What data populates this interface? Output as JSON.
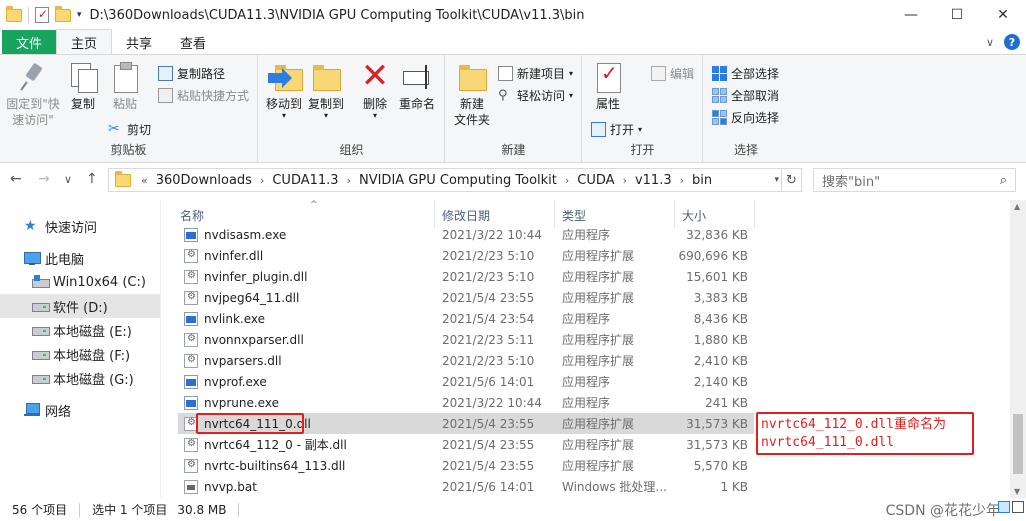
{
  "titlebar": {
    "path": "D:\\360Downloads\\CUDA11.3\\NVIDIA GPU Computing Toolkit\\CUDA\\v11.3\\bin",
    "minimize": "—",
    "maximize": "☐",
    "close": "✕",
    "qa_dropdown": "▾"
  },
  "tabs": {
    "file": "文件",
    "home": "主页",
    "share": "共享",
    "view": "查看",
    "expand": "∨",
    "help": "?"
  },
  "ribbon": {
    "clipboard": {
      "label": "剪贴板",
      "pin": "固定到\"快速访问\"",
      "copy": "复制",
      "paste": "粘贴",
      "copy_path": "复制路径",
      "paste_shortcut": "粘贴快捷方式",
      "cut": "剪切"
    },
    "organize": {
      "label": "组织",
      "move_to": "移动到",
      "copy_to": "复制到",
      "delete": "删除",
      "rename": "重命名"
    },
    "new": {
      "label": "新建",
      "new_folder": "新建\n文件夹",
      "new_item": "新建项目",
      "easy_access": "轻松访问"
    },
    "open": {
      "label": "打开",
      "properties": "属性",
      "open": "打开",
      "edit": "编辑"
    },
    "select": {
      "label": "选择",
      "select_all": "全部选择",
      "select_none": "全部取消",
      "invert": "反向选择"
    }
  },
  "address": {
    "back": "←",
    "forward": "→",
    "recent": "∨",
    "up": "↑",
    "overflow": "«",
    "crumbs": [
      "360Downloads",
      "CUDA11.3",
      "NVIDIA GPU Computing Toolkit",
      "CUDA",
      "v11.3",
      "bin"
    ],
    "refresh": "↻",
    "search_placeholder": "搜索\"bin\"",
    "search_icon": "⌕"
  },
  "nav": {
    "quick_access": "快速访问",
    "this_pc": "此电脑",
    "drive_c": "Win10x64 (C:)",
    "drive_d": "软件 (D:)",
    "drive_e": "本地磁盘 (E:)",
    "drive_f": "本地磁盘 (F:)",
    "drive_g": "本地磁盘 (G:)",
    "network": "网络"
  },
  "columns": {
    "name": "名称",
    "date": "修改日期",
    "type": "类型",
    "size": "大小",
    "sort": "^"
  },
  "files": [
    {
      "name": "nvdisasm.exe",
      "date": "2021/3/22 10:44",
      "type": "应用程序",
      "size": "32,836 KB",
      "icon": "exe"
    },
    {
      "name": "nvinfer.dll",
      "date": "2021/2/23 5:10",
      "type": "应用程序扩展",
      "size": "690,696 KB",
      "icon": "dll"
    },
    {
      "name": "nvinfer_plugin.dll",
      "date": "2021/2/23 5:10",
      "type": "应用程序扩展",
      "size": "15,601 KB",
      "icon": "dll"
    },
    {
      "name": "nvjpeg64_11.dll",
      "date": "2021/5/4 23:55",
      "type": "应用程序扩展",
      "size": "3,383 KB",
      "icon": "dll"
    },
    {
      "name": "nvlink.exe",
      "date": "2021/5/4 23:54",
      "type": "应用程序",
      "size": "8,436 KB",
      "icon": "exe"
    },
    {
      "name": "nvonnxparser.dll",
      "date": "2021/2/23 5:11",
      "type": "应用程序扩展",
      "size": "1,880 KB",
      "icon": "dll"
    },
    {
      "name": "nvparsers.dll",
      "date": "2021/2/23 5:10",
      "type": "应用程序扩展",
      "size": "2,410 KB",
      "icon": "dll"
    },
    {
      "name": "nvprof.exe",
      "date": "2021/5/6 14:01",
      "type": "应用程序",
      "size": "2,140 KB",
      "icon": "exe"
    },
    {
      "name": "nvprune.exe",
      "date": "2021/3/22 10:44",
      "type": "应用程序",
      "size": "241 KB",
      "icon": "exe"
    },
    {
      "name": "nvrtc64_111_0.dll",
      "date": "2021/5/4 23:55",
      "type": "应用程序扩展",
      "size": "31,573 KB",
      "icon": "dll"
    },
    {
      "name": "nvrtc64_112_0 - 副本.dll",
      "date": "2021/5/4 23:55",
      "type": "应用程序扩展",
      "size": "31,573 KB",
      "icon": "dll"
    },
    {
      "name": "nvrtc-builtins64_113.dll",
      "date": "2021/5/4 23:55",
      "type": "应用程序扩展",
      "size": "5,570 KB",
      "icon": "dll"
    },
    {
      "name": "nvvp.bat",
      "date": "2021/5/6 14:01",
      "type": "Windows 批处理...",
      "size": "1 KB",
      "icon": "bat"
    }
  ],
  "annotation": {
    "line1": "nvrtc64_112_0.dll重命名为",
    "line2": "nvrtc64_111_0.dll"
  },
  "status": {
    "count": "56 个项目",
    "selected": "选中 1 个项目",
    "size": "30.8 MB"
  },
  "watermark": "CSDN @花花少年",
  "colors": {
    "file_tab": "#19a45e",
    "selection": "#cce8ff",
    "annotation_red": "#e02020",
    "accent_blue": "#2d7de0"
  }
}
